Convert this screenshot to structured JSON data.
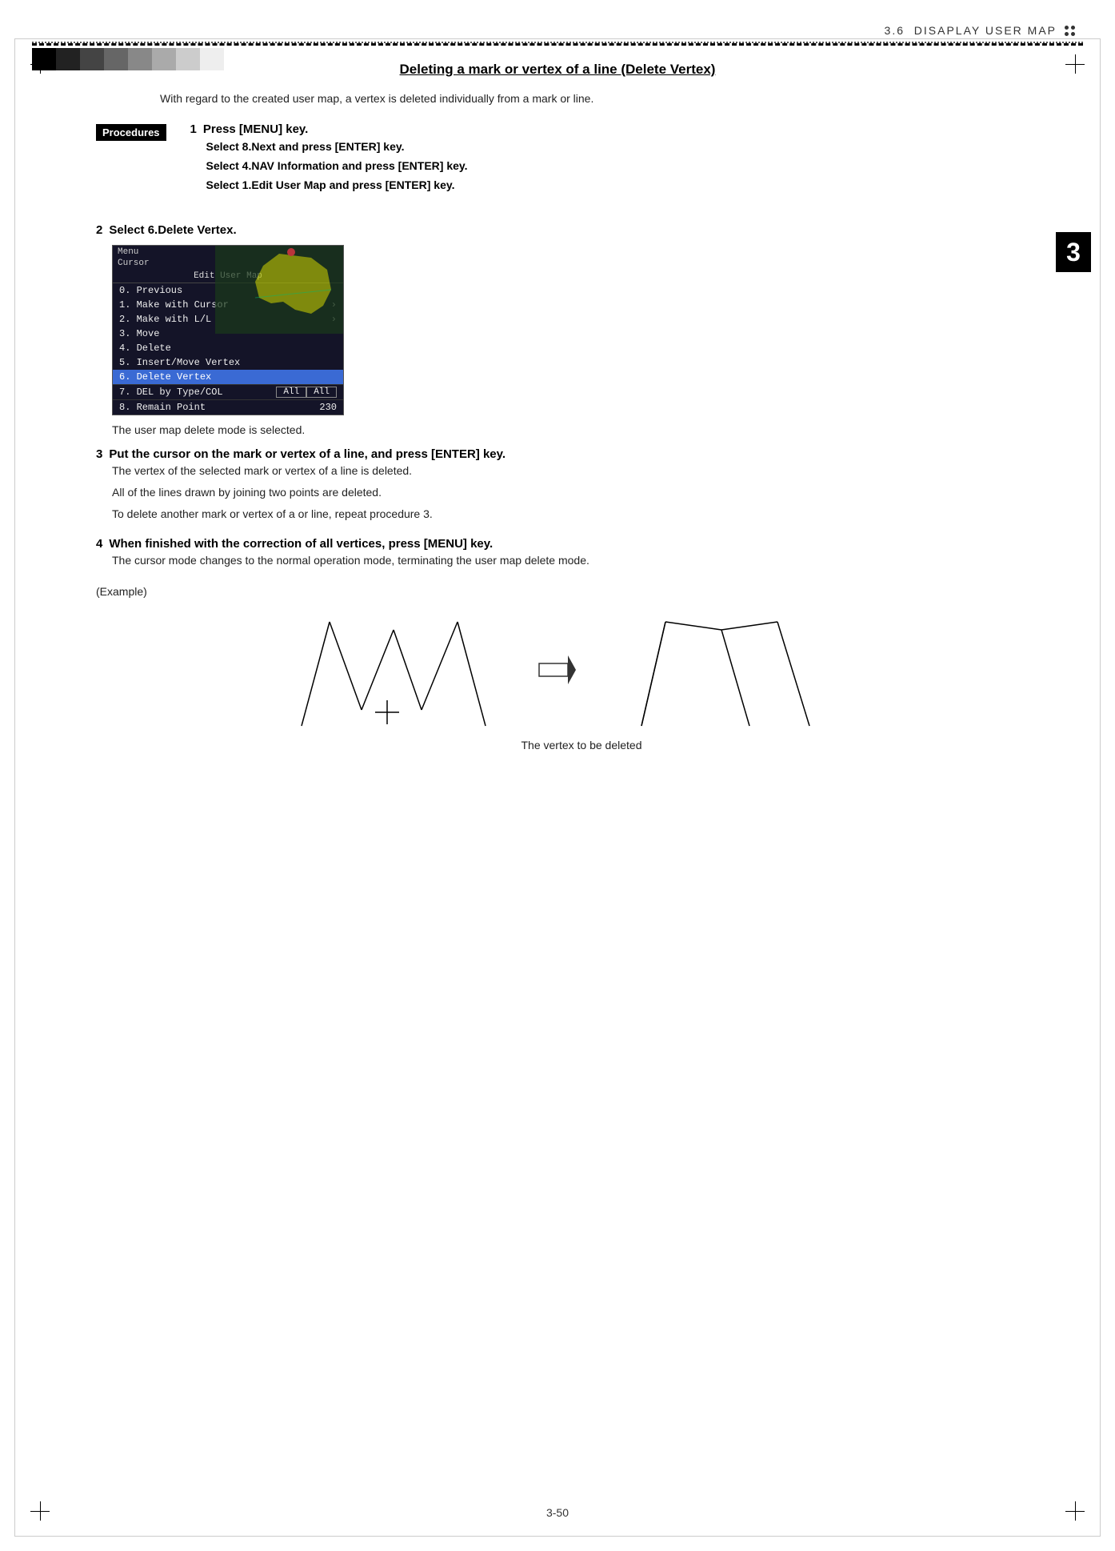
{
  "header": {
    "section": "3.6",
    "title": "DISAPLAY USER MAP"
  },
  "grayscale_colors": [
    "#000000",
    "#222222",
    "#444444",
    "#666666",
    "#888888",
    "#aaaaaa",
    "#cccccc",
    "#eeeeee",
    "#ffffff"
  ],
  "section_title": "Deleting a mark or vertex of a line (Delete Vertex)",
  "intro": "With regard to the created user map, a vertex is deleted individually from a mark or line.",
  "procedures_label": "Procedures",
  "steps": [
    {
      "number": "1",
      "header": "Press [MENU] key.",
      "details": [
        "Select   8.Next   and press [ENTER] key.",
        "Select   4.NAV Information and press [ENTER] key.",
        "Select   1.Edit User Map and press [ENTER] key."
      ]
    },
    {
      "number": "2",
      "header": "Select 6.Delete Vertex.",
      "details": []
    },
    {
      "number": "3",
      "header": "Put the cursor on the mark or vertex of a line, and press [ENTER] key.",
      "details": []
    },
    {
      "number": "4",
      "header": "When finished with the correction of all vertices, press [MENU] key.",
      "details": []
    }
  ],
  "menu": {
    "top_items": [
      "Menu",
      "Cursor"
    ],
    "edit_title": "Edit User Map",
    "items": [
      {
        "text": "0. Previous",
        "arrow": false,
        "highlighted": false
      },
      {
        "text": "1. Make with Cursor",
        "arrow": true,
        "highlighted": false
      },
      {
        "text": "2. Make with L/L",
        "arrow": true,
        "highlighted": false
      },
      {
        "text": "3. Move",
        "arrow": false,
        "highlighted": false
      },
      {
        "text": "4. Delete",
        "arrow": false,
        "highlighted": false
      },
      {
        "text": "5. Insert/Move Vertex",
        "arrow": false,
        "highlighted": false
      },
      {
        "text": "6. Delete Vertex",
        "arrow": false,
        "highlighted": true
      },
      {
        "text": "7. DEL by Type/COL",
        "arrow": false,
        "highlighted": false
      },
      {
        "text": "8. Remain Point",
        "arrow": false,
        "highlighted": false
      }
    ],
    "bottom_col1": "All",
    "bottom_col2": "All",
    "bottom_remain": "230"
  },
  "after_menu_caption": "The user map delete mode is selected.",
  "step3_body": [
    "The vertex of the selected mark or vertex of a line is deleted.",
    "All of the lines drawn by joining two points are deleted.",
    "To delete another mark or vertex of a or line, repeat procedure 3."
  ],
  "step4_body": [
    "The cursor mode changes to the normal operation mode, terminating the user map delete mode."
  ],
  "example_label": "(Example)",
  "vertex_label": "The vertex to be deleted",
  "chapter_number": "3",
  "page_number": "3-50"
}
